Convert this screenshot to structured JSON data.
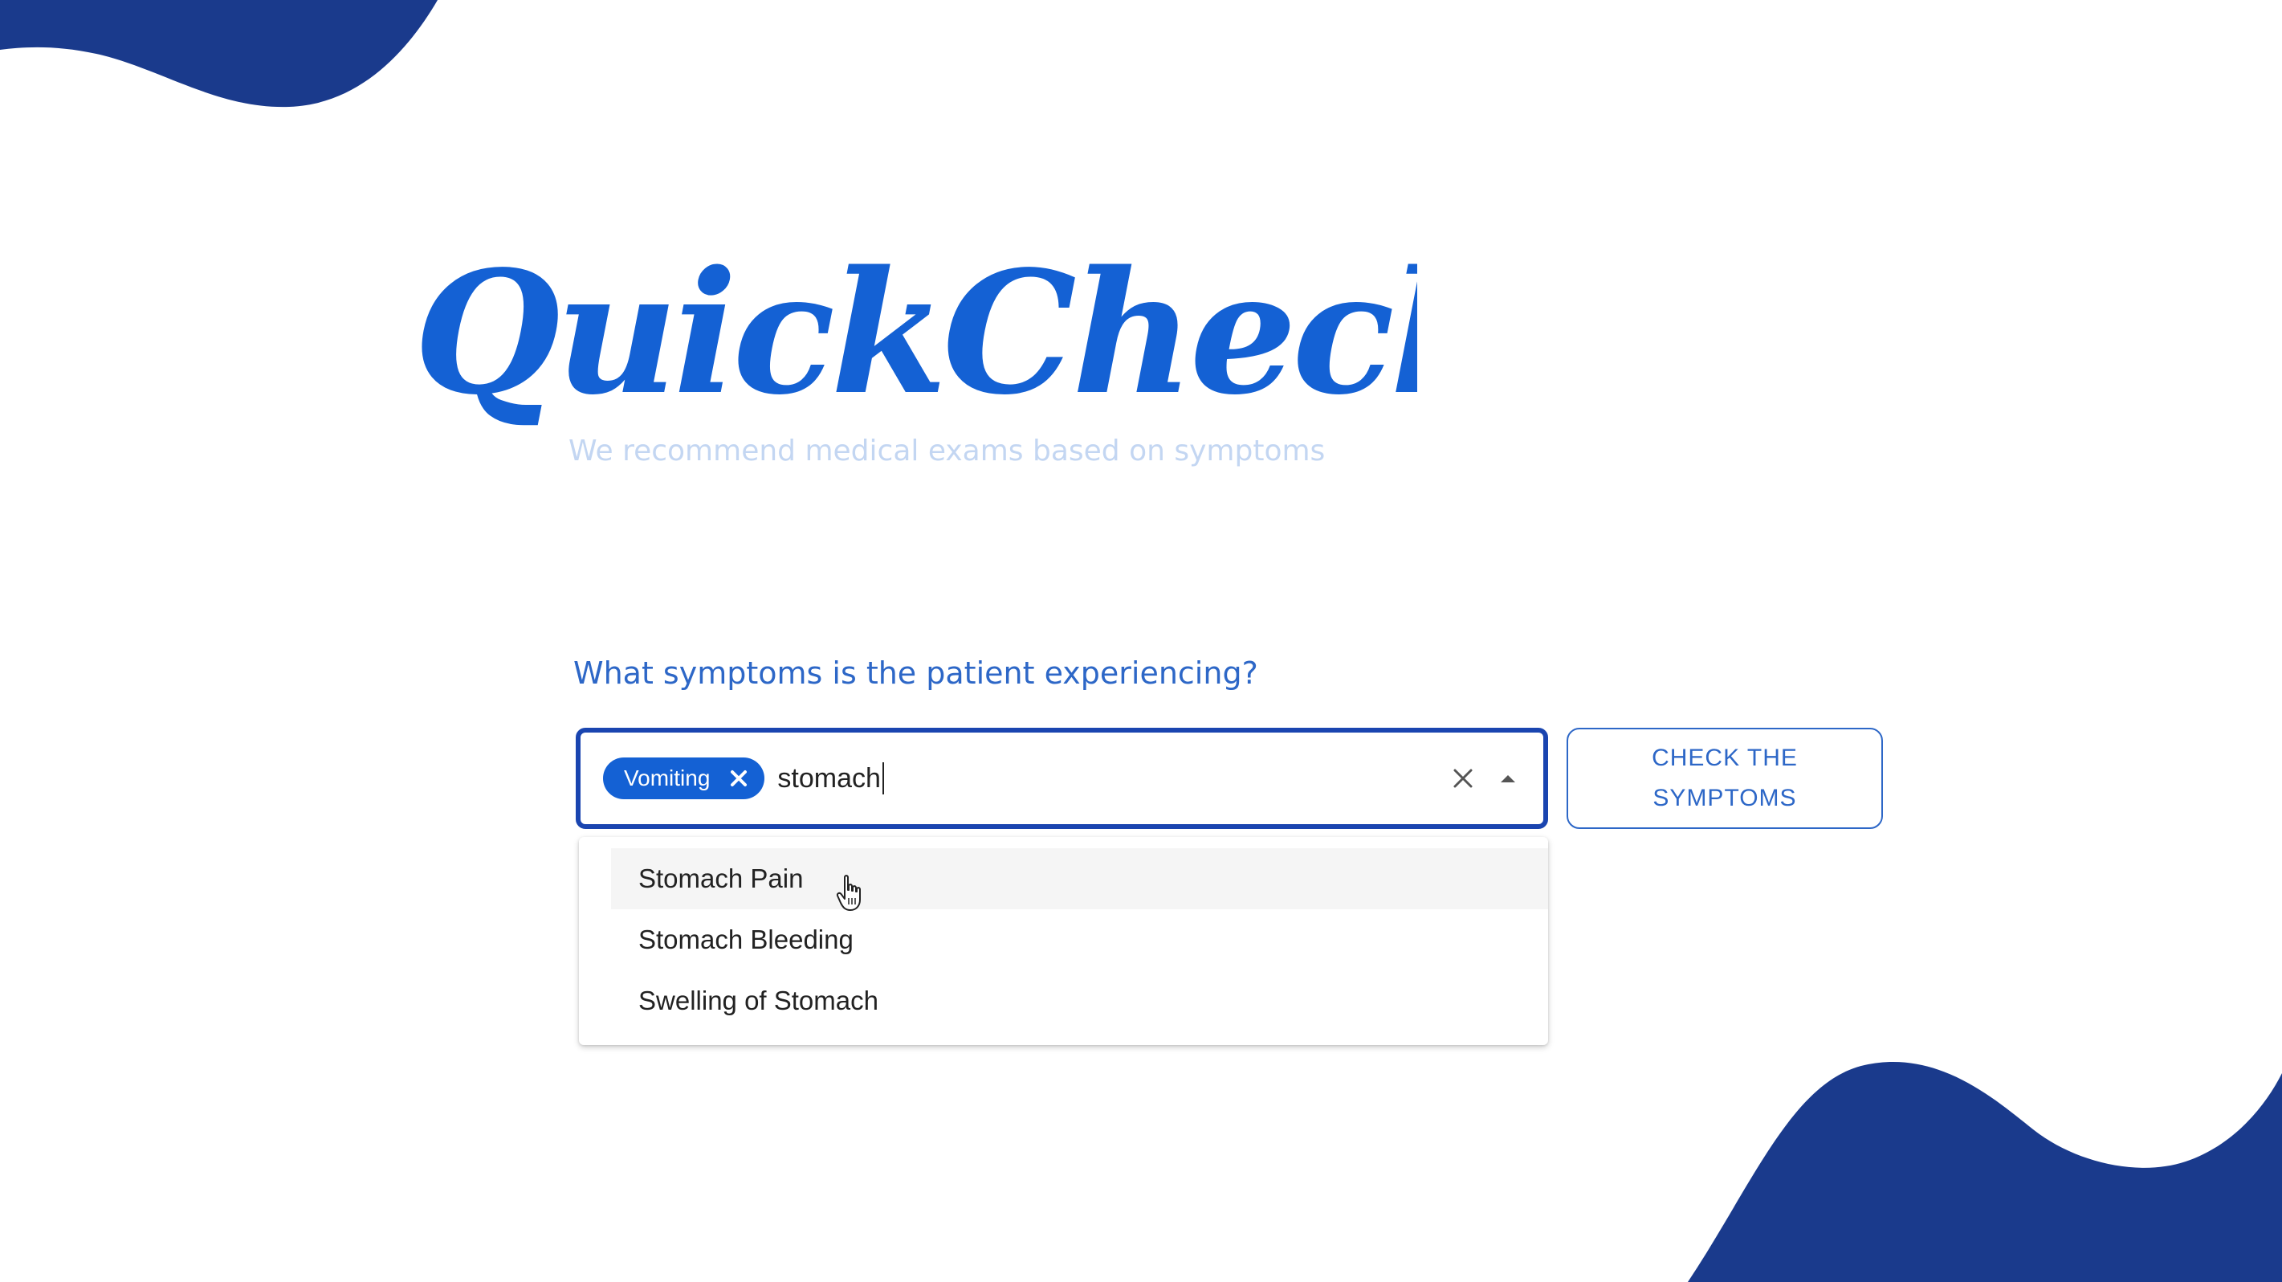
{
  "brand": {
    "name": "QuickCheck",
    "tagline": "We recommend medical exams based on symptoms",
    "logo_color": "#1461d4"
  },
  "form": {
    "question": "What symptoms is the patient experiencing?",
    "selected_symptoms": [
      {
        "label": "Vomiting"
      }
    ],
    "input_value": "stomach",
    "submit_label": "CHECK THE SYMPTOMS"
  },
  "dropdown": {
    "open": true,
    "highlighted_index": 0,
    "options": [
      {
        "label": "Stomach Pain"
      },
      {
        "label": "Stomach Bleeding"
      },
      {
        "label": "Swelling of Stomach"
      }
    ]
  },
  "icons": {
    "chip_remove": "close-icon",
    "clear": "close-icon",
    "toggle": "caret-up-icon",
    "pointer": "hand-pointer-icon"
  },
  "colors": {
    "accent": "#1461d4",
    "decor": "#1a3a8c",
    "input_border": "#1a45b0",
    "button_text": "#2d67c7",
    "tagline": "#c3d6f2"
  }
}
